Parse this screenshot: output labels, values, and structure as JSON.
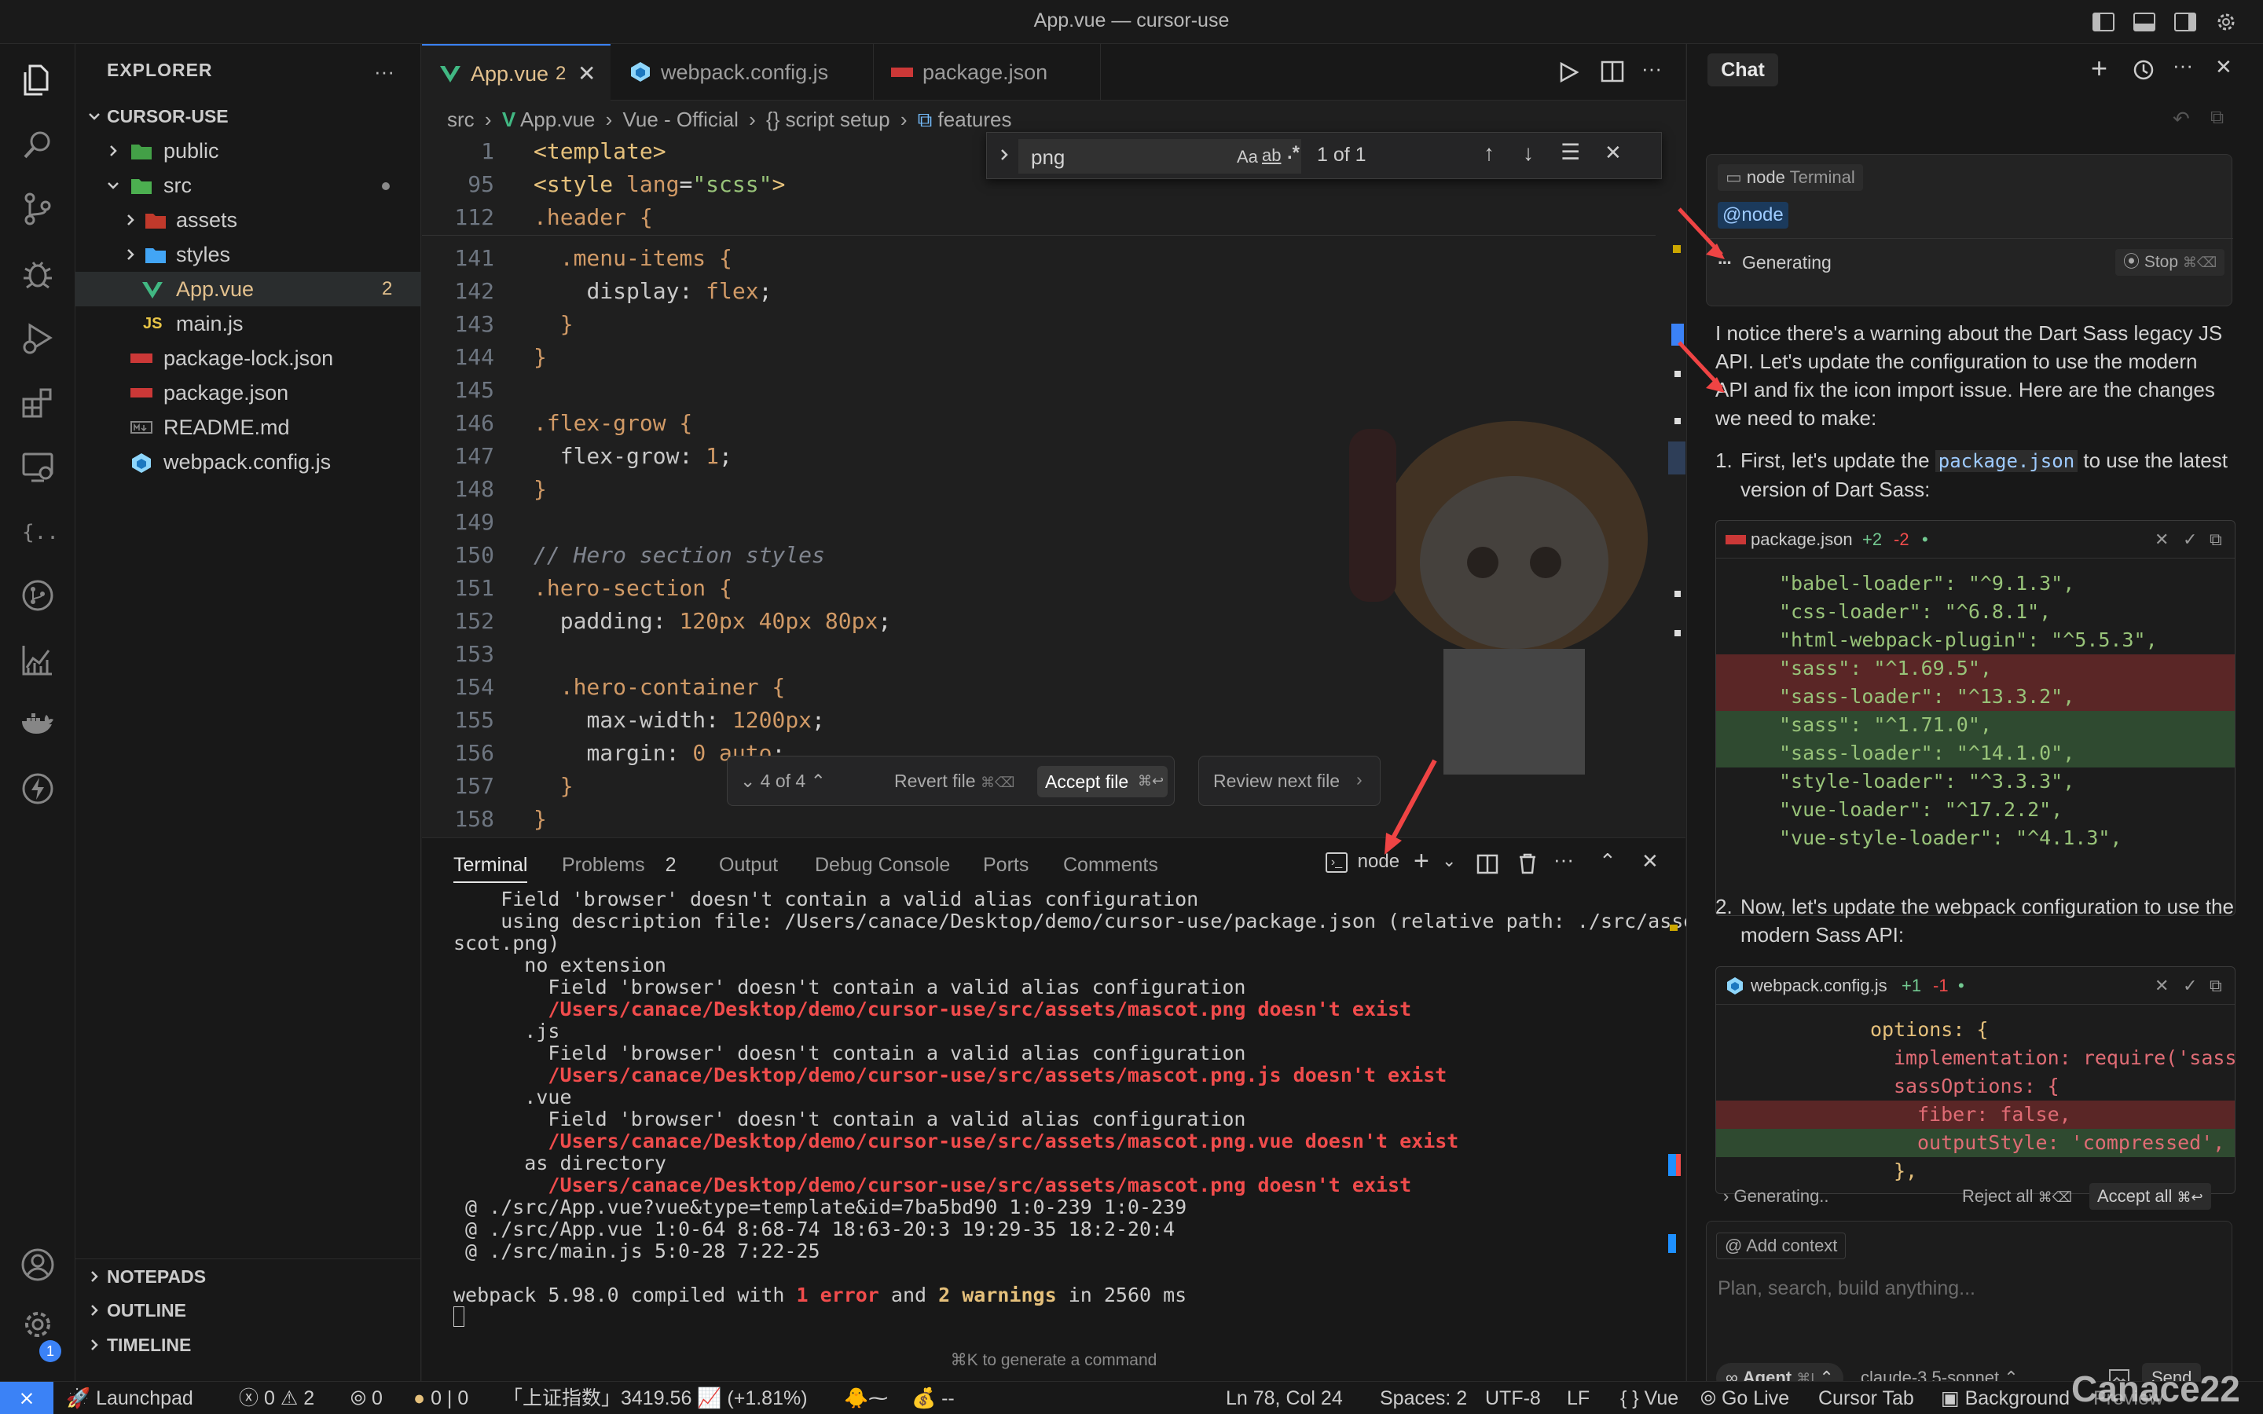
{
  "window": {
    "title": "App.vue — cursor-use"
  },
  "explorer": {
    "header": "EXPLORER",
    "root": "CURSOR-USE",
    "items": [
      {
        "label": "public"
      },
      {
        "label": "src"
      },
      {
        "label": "assets"
      },
      {
        "label": "styles"
      },
      {
        "label": "App.vue",
        "badge": "2"
      },
      {
        "label": "main.js"
      },
      {
        "label": "package-lock.json"
      },
      {
        "label": "package.json"
      },
      {
        "label": "README.md"
      },
      {
        "label": "webpack.config.js"
      }
    ],
    "sections": [
      "NOTEPADS",
      "OUTLINE",
      "TIMELINE"
    ]
  },
  "tabs": [
    {
      "label": "App.vue",
      "badge": "2"
    },
    {
      "label": "webpack.config.js"
    },
    {
      "label": "package.json"
    }
  ],
  "breadcrumb": [
    "src",
    "App.vue",
    "Vue - Official",
    "{} script setup",
    "features"
  ],
  "find": {
    "query": "png",
    "aa": "Aa",
    "ab": "ab",
    "regex": ".*",
    "result": "1 of 1"
  },
  "code": [
    {
      "n": "1",
      "t": "<template>"
    },
    {
      "n": "95",
      "t": "<style lang=\"scss\">"
    },
    {
      "n": "112",
      "t": ".header {"
    },
    {
      "n": "141",
      "t": "  .menu-items {"
    },
    {
      "n": "142",
      "t": "    display: flex;"
    },
    {
      "n": "143",
      "t": "  }"
    },
    {
      "n": "144",
      "t": "}"
    },
    {
      "n": "145",
      "t": ""
    },
    {
      "n": "146",
      "t": ".flex-grow {"
    },
    {
      "n": "147",
      "t": "  flex-grow: 1;"
    },
    {
      "n": "148",
      "t": "}"
    },
    {
      "n": "149",
      "t": ""
    },
    {
      "n": "150",
      "t": "// Hero section styles"
    },
    {
      "n": "151",
      "t": ".hero-section {"
    },
    {
      "n": "152",
      "t": "  padding: 120px 40px 80px;"
    },
    {
      "n": "153",
      "t": ""
    },
    {
      "n": "154",
      "t": "  .hero-container {"
    },
    {
      "n": "155",
      "t": "    max-width: 1200px;"
    },
    {
      "n": "156",
      "t": "    margin: 0 auto;"
    },
    {
      "n": "157",
      "t": "  }"
    },
    {
      "n": "158",
      "t": "}"
    }
  ],
  "review": {
    "counter": "4 of 4",
    "revert": "Revert file",
    "revert_kbd": "⌘⌫",
    "accept": "Accept file",
    "accept_kbd": "⌘↩",
    "next": "Review next file"
  },
  "panel": {
    "tabs": [
      "Terminal",
      "Problems",
      "Output",
      "Debug Console",
      "Ports",
      "Comments"
    ],
    "problems_count": "2",
    "terminal_name": "node",
    "lines": [
      {
        "t": "    Field 'browser' doesn't contain a valid alias configuration",
        "e": false
      },
      {
        "t": "    using description file: /Users/canace/Desktop/demo/cursor-use/package.json (relative path: ./src/assets/ma",
        "e": false
      },
      {
        "t": "scot.png)",
        "e": false
      },
      {
        "t": "      no extension",
        "e": false
      },
      {
        "t": "        Field 'browser' doesn't contain a valid alias configuration",
        "e": false
      },
      {
        "t": "        /Users/canace/Desktop/demo/cursor-use/src/assets/mascot.png doesn't exist",
        "e": true
      },
      {
        "t": "      .js",
        "e": false
      },
      {
        "t": "        Field 'browser' doesn't contain a valid alias configuration",
        "e": false
      },
      {
        "t": "        /Users/canace/Desktop/demo/cursor-use/src/assets/mascot.png.js doesn't exist",
        "e": true
      },
      {
        "t": "      .vue",
        "e": false
      },
      {
        "t": "        Field 'browser' doesn't contain a valid alias configuration",
        "e": false
      },
      {
        "t": "        /Users/canace/Desktop/demo/cursor-use/src/assets/mascot.png.vue doesn't exist",
        "e": true
      },
      {
        "t": "      as directory",
        "e": false
      },
      {
        "t": "        /Users/canace/Desktop/demo/cursor-use/src/assets/mascot.png doesn't exist",
        "e": true
      },
      {
        "t": " @ ./src/App.vue?vue&type=template&id=7ba5bd90 1:0-239 1:0-239",
        "e": false
      },
      {
        "t": " @ ./src/App.vue 1:0-64 8:68-74 18:63-20:3 19:29-35 18:2-20:4",
        "e": false
      },
      {
        "t": " @ ./src/main.js 5:0-28 7:22-25",
        "e": false
      }
    ],
    "compile_prefix": "webpack 5.98.0 compiled with ",
    "compile_errors": "1 error",
    "compile_and": " and ",
    "compile_warnings": "2 warnings",
    "compile_suffix": " in 2560 ms",
    "hint": "⌘K to generate a command"
  },
  "chat": {
    "tab": "Chat",
    "terminal_chip_name": "node",
    "terminal_chip_label": "Terminal",
    "mention": "@node",
    "generating": "Generating",
    "stop": "Stop",
    "stop_kbd": "⌘⌫",
    "message_p1": "I notice there's a warning about the Dart Sass legacy JS API. Let's update the configuration to use the modern API and fix the icon import issue. Here are the changes we need to make:",
    "step1_pre": "First, let's update the ",
    "step1_code": "package.json",
    "step1_post": " to use the latest version of Dart Sass:",
    "step2": "Now, let's update the webpack configuration to use the modern Sass API:",
    "diff1": {
      "file": "package.json",
      "add": "+2",
      "del": "-2",
      "lines": [
        {
          "t": "\"babel-loader\": \"^9.1.3\",",
          "k": "ctx"
        },
        {
          "t": "\"css-loader\": \"^6.8.1\",",
          "k": "ctx"
        },
        {
          "t": "\"html-webpack-plugin\": \"^5.5.3\",",
          "k": "ctx"
        },
        {
          "t": "\"sass\": \"^1.69.5\",",
          "k": "del"
        },
        {
          "t": "\"sass-loader\": \"^13.3.2\",",
          "k": "del"
        },
        {
          "t": "\"sass\": \"^1.71.0\",",
          "k": "add"
        },
        {
          "t": "\"sass-loader\": \"^14.1.0\",",
          "k": "add"
        },
        {
          "t": "\"style-loader\": \"^3.3.3\",",
          "k": "ctx"
        },
        {
          "t": "\"vue-loader\": \"^17.2.2\",",
          "k": "ctx"
        },
        {
          "t": "\"vue-style-loader\": \"^4.1.3\",",
          "k": "ctx"
        }
      ]
    },
    "diff2": {
      "file": "webpack.config.js",
      "add": "+1",
      "del": "-1",
      "lines": [
        {
          "t": "options: {",
          "k": "ctx",
          "ind": 0
        },
        {
          "t": "implementation: require('sass'",
          "k": "ctx",
          "ind": 1
        },
        {
          "t": "sassOptions: {",
          "k": "ctx",
          "ind": 1
        },
        {
          "t": "fiber: false,",
          "k": "del",
          "ind": 2
        },
        {
          "t": "outputStyle: 'compressed',",
          "k": "add",
          "ind": 2
        },
        {
          "t": "},",
          "k": "ctx",
          "ind": 1
        }
      ]
    },
    "generating_footer": "Generating..",
    "reject_all": "Reject all",
    "reject_kbd": "⌘⌫",
    "accept_all": "Accept all",
    "accept_kbd": "⌘↩",
    "add_context": "Add context",
    "input_placeholder": "Plan, search, build anything...",
    "agent": "Agent",
    "agent_kbd": "⌘I",
    "model": "claude-3.5-sonnet",
    "send": "Send"
  },
  "status": {
    "launchpad": "Launchpad",
    "errors": "0",
    "warnings": "2",
    "ports": "0",
    "bits": "0 | 0",
    "stock": "「上证指数」3419.56 📈 (+1.81%)",
    "dashes": "--",
    "position": "Ln 78, Col 24",
    "spaces": "Spaces: 2",
    "encoding": "UTF-8",
    "eol": "LF",
    "lang": "Vue",
    "golive": "Go Live",
    "cursortab": "Cursor Tab",
    "background": "Background",
    "preview": "Preview",
    "watermark": "Canace22",
    "settings_badge": "1"
  },
  "colors": {
    "accent": "#3b82f6",
    "error": "#f14c4c",
    "warning": "#cca700",
    "vue": "#41b883",
    "add_bg": "#2f4a30",
    "del_bg": "#5a2626"
  }
}
